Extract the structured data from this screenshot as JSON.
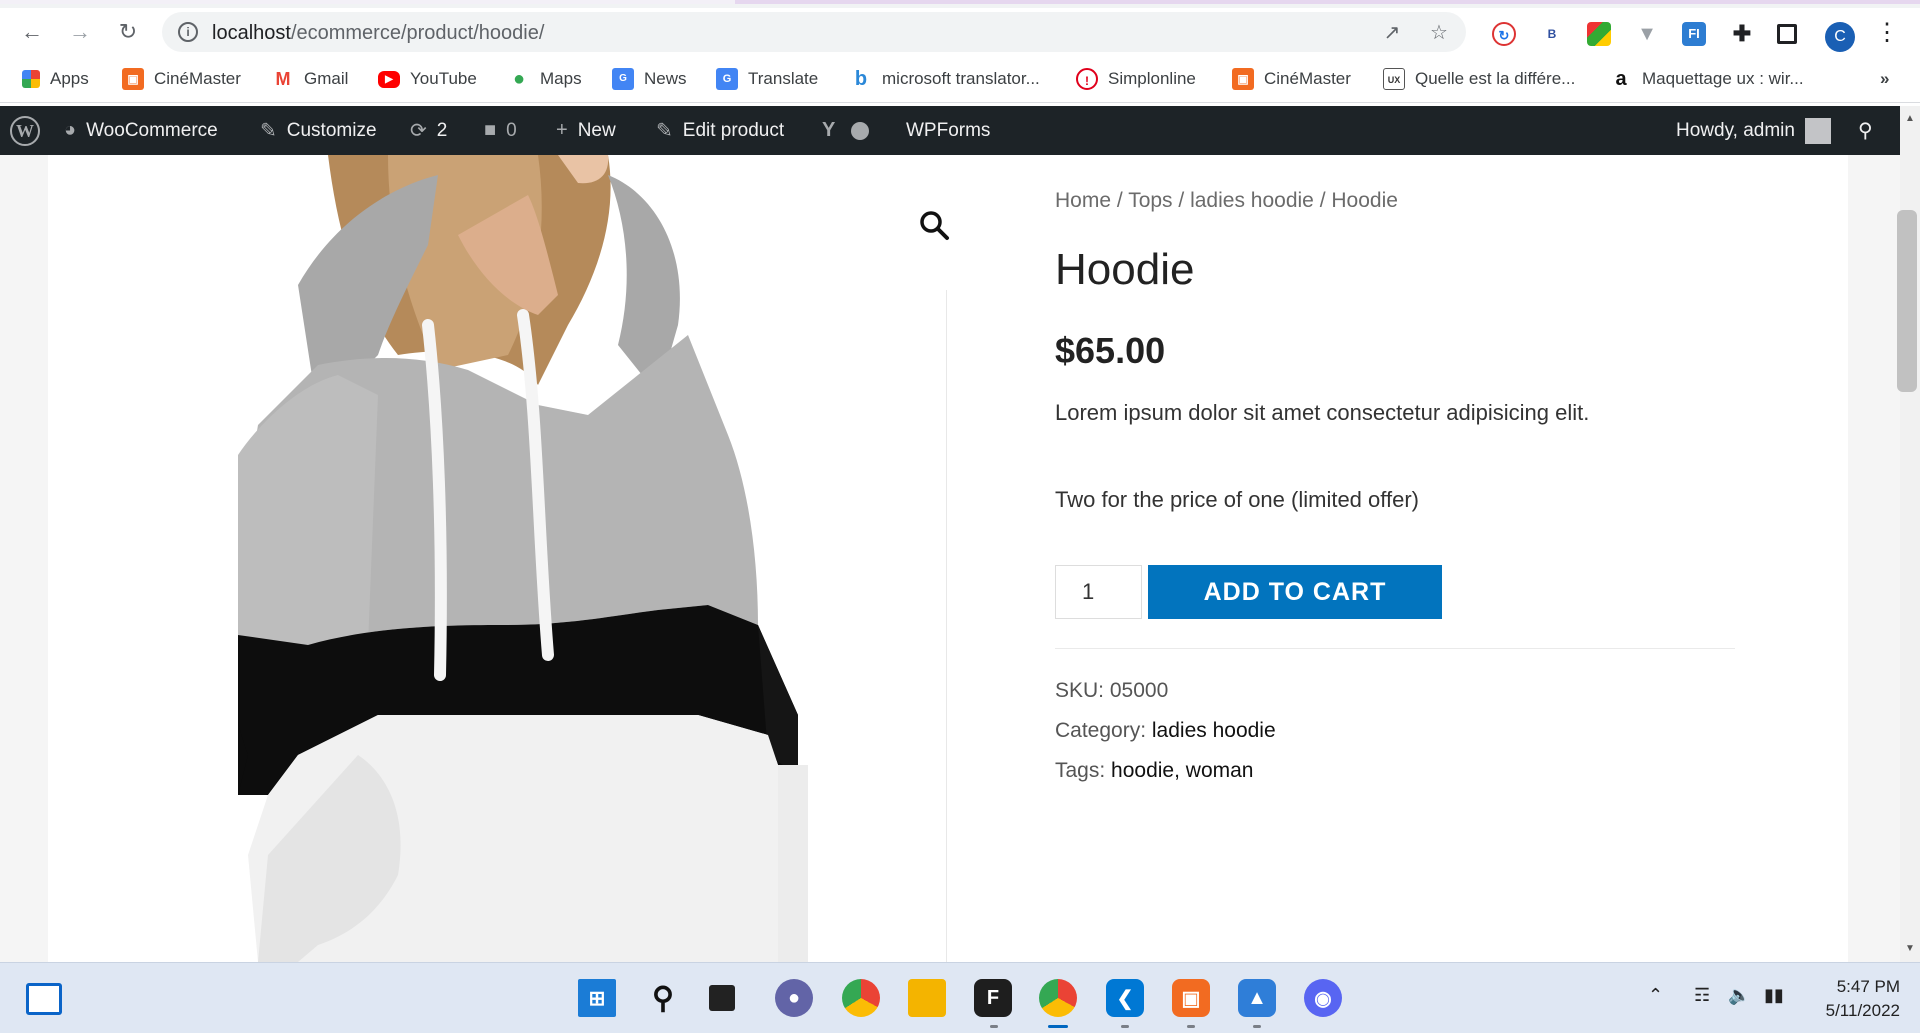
{
  "browser": {
    "url_host": "localhost",
    "url_path": "/ecommerce/product/hoodie/",
    "profile_initial": "C",
    "bookmarks": [
      {
        "label": "Apps",
        "icon": "apps-grid-icon",
        "color": "#4285f4"
      },
      {
        "label": "CinéMaster",
        "icon": "cinemaster-icon",
        "color": "#f26b21"
      },
      {
        "label": "Gmail",
        "icon": "gmail-icon",
        "color": "#ea4335"
      },
      {
        "label": "YouTube",
        "icon": "youtube-icon",
        "color": "#ff0000"
      },
      {
        "label": "Maps",
        "icon": "maps-pin-icon",
        "color": "#34a853"
      },
      {
        "label": "News",
        "icon": "news-icon",
        "color": "#4285f4"
      },
      {
        "label": "Translate",
        "icon": "translate-icon",
        "color": "#4285f4"
      },
      {
        "label": "microsoft translator...",
        "icon": "bing-icon",
        "color": "#2b88d8"
      },
      {
        "label": "Simplonline",
        "icon": "simplonline-icon",
        "color": "#e0001b"
      },
      {
        "label": "CinéMaster",
        "icon": "cinemaster-icon",
        "color": "#f26b21"
      },
      {
        "label": "Quelle est la différe...",
        "icon": "blog-ux-icon",
        "color": "#555555"
      },
      {
        "label": "Maquettage ux : wir...",
        "icon": "amazon-icon",
        "color": "#111111"
      }
    ],
    "overflow": "»"
  },
  "adminbar": {
    "woocommerce": "WooCommerce",
    "customize": "Customize",
    "updates_count": "2",
    "comments_count": "0",
    "new": "New",
    "edit_product": "Edit product",
    "wpforms": "WPForms",
    "howdy": "Howdy, admin"
  },
  "product": {
    "breadcrumb": {
      "home": "Home",
      "sep": "/",
      "cat1": "Tops",
      "cat2": "ladies hoodie",
      "current": "Hoodie"
    },
    "title": "Hoodie",
    "price": "$65.00",
    "description": "Lorem ipsum dolor sit amet consectetur adipisicing elit.",
    "offer": "Two for the price of one (limited offer)",
    "quantity": "1",
    "add_to_cart": "ADD TO CART",
    "sku_label": "SKU:",
    "sku": "05000",
    "category_label": "Category:",
    "category": "ladies hoodie",
    "tags_label": "Tags:",
    "tags": "hoodie, woman"
  },
  "taskbar": {
    "time": "5:47 PM",
    "date": "5/11/2022"
  },
  "colors": {
    "accent_button": "#0274be",
    "admin_bar": "#1d2327"
  }
}
